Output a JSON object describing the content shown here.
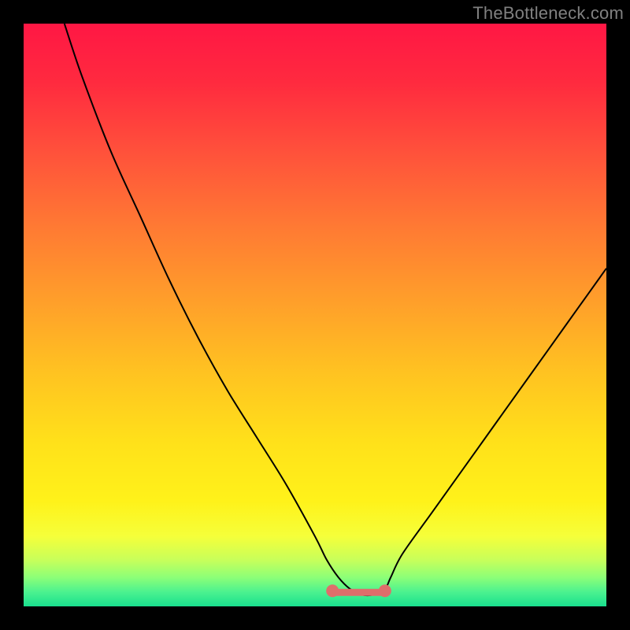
{
  "attribution": "TheBottleneck.com",
  "chart_data": {
    "type": "line",
    "title": "",
    "xlabel": "",
    "ylabel": "",
    "xlim": [
      0,
      100
    ],
    "ylim": [
      0,
      100
    ],
    "grid": false,
    "series": [
      {
        "name": "bottleneck-curve",
        "x": [
          7,
          10,
          15,
          20,
          25,
          30,
          35,
          40,
          45,
          50,
          52,
          54,
          56,
          58,
          60,
          62,
          63,
          65,
          70,
          75,
          80,
          85,
          90,
          95,
          100
        ],
        "values": [
          100,
          91,
          78,
          67,
          56,
          46,
          37,
          29,
          21,
          12,
          8,
          5,
          3,
          2,
          2,
          3,
          5,
          9,
          16,
          23,
          30,
          37,
          44,
          51,
          58
        ]
      }
    ],
    "flat_segment": {
      "x_from": 53,
      "x_to": 62,
      "y": 2.4
    },
    "flat_segment_color": "#de6e6b",
    "background_gradient_stops": [
      {
        "offset": 0.0,
        "color": "#ff1744"
      },
      {
        "offset": 0.1,
        "color": "#ff2a3f"
      },
      {
        "offset": 0.22,
        "color": "#ff513b"
      },
      {
        "offset": 0.35,
        "color": "#ff7a33"
      },
      {
        "offset": 0.48,
        "color": "#ffa02a"
      },
      {
        "offset": 0.6,
        "color": "#ffc321"
      },
      {
        "offset": 0.72,
        "color": "#ffe11a"
      },
      {
        "offset": 0.82,
        "color": "#fff21a"
      },
      {
        "offset": 0.88,
        "color": "#f5ff3a"
      },
      {
        "offset": 0.92,
        "color": "#c8ff5a"
      },
      {
        "offset": 0.95,
        "color": "#8dff77"
      },
      {
        "offset": 0.975,
        "color": "#4cf28f"
      },
      {
        "offset": 1.0,
        "color": "#19e08e"
      }
    ]
  }
}
